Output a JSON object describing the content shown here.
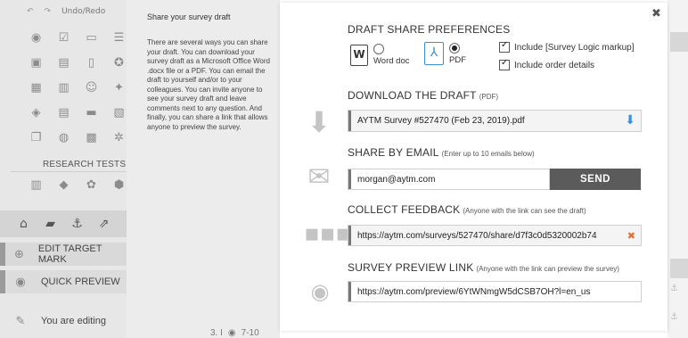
{
  "sidebar": {
    "undo_label": "Undo/Redo",
    "research_label": "RESEARCH TESTS",
    "menu": {
      "target": "EDIT TARGET MARK",
      "preview": "QUICK PREVIEW",
      "editing": "You are editing"
    }
  },
  "info": {
    "title": "Share your survey draft",
    "text": "There are several ways you can share your draft. You can download your survey draft as a Microsoft Office Word .docx file or a PDF. You can email the draft to yourself and/or to your colleagues. You can invite anyone to see your survey draft and leave comments next to any question. And finally, you can share a link that allows anyone to preview the survey."
  },
  "prefs": {
    "title": "DRAFT SHARE PREFERENCES",
    "word_label": "Word doc",
    "pdf_label": "PDF",
    "logic_label": "Include [Survey Logic markup]",
    "order_label": "Include order details"
  },
  "download": {
    "title": "DOWNLOAD THE DRAFT",
    "note": "(PDF)",
    "file": "AYTM Survey #527470 (Feb 23, 2019).pdf"
  },
  "email": {
    "title": "SHARE BY EMAIL",
    "note": "(Enter up to 10 emails below)",
    "value": "morgan@aytm.com",
    "send": "SEND"
  },
  "feedback": {
    "title": "COLLECT FEEDBACK",
    "note": "(Anyone with the link can see the draft)",
    "link": "https://aytm.com/surveys/527470/share/d7f3c0d5320002b74"
  },
  "preview": {
    "title": "SURVEY PREVIEW LINK",
    "note": "(Anyone with the link can preview the survey)",
    "link": "https://aytm.com/preview/6YtWNmgW5dCSB7OH?l=en_us"
  },
  "background": {
    "row_number": "3. I",
    "row_range": "7-10"
  },
  "colors": {
    "accent": "#3a8fd8",
    "send_button": "#5b5b5b",
    "remove_mark": "#e07030"
  }
}
